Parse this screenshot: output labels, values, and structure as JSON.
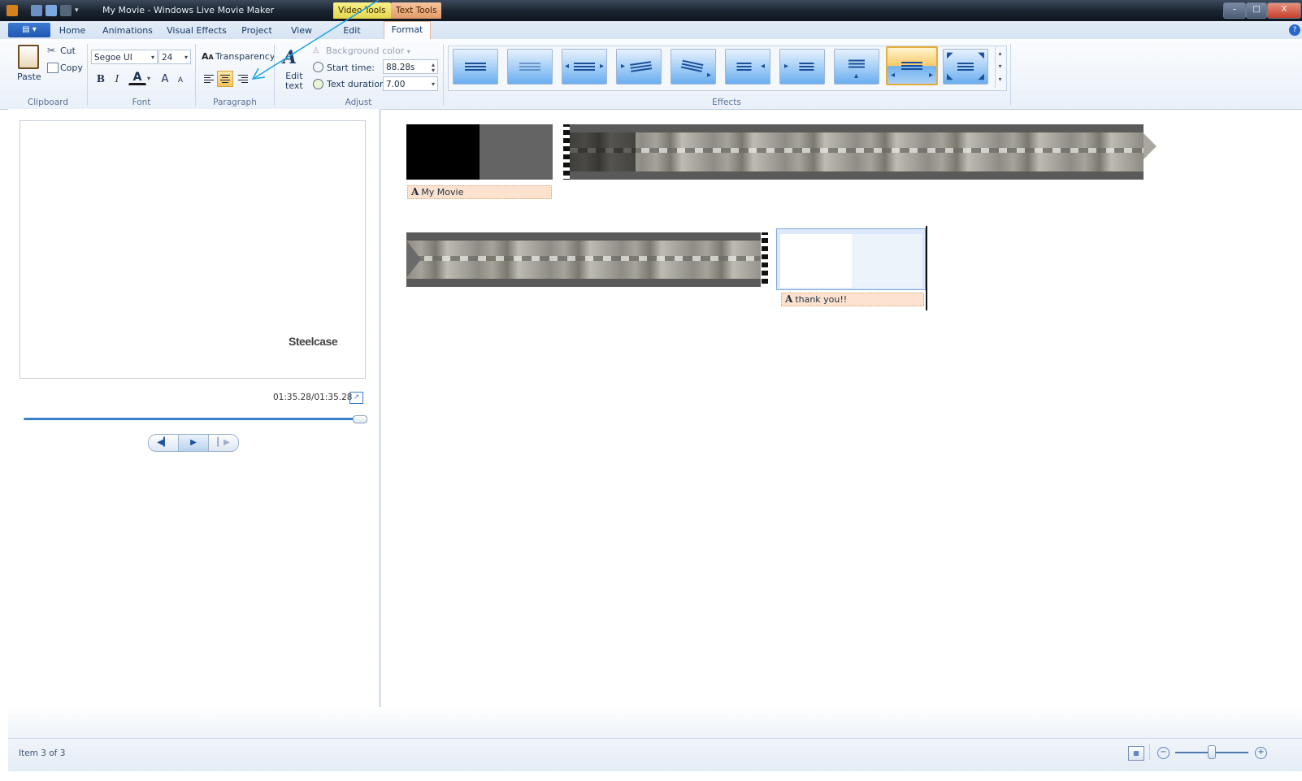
{
  "window": {
    "title": "My Movie - Windows Live Movie Maker",
    "context_tabs": {
      "video_tools": "Video Tools",
      "text_tools": "Text Tools"
    },
    "controls": {
      "minimize": "–",
      "maximize": "□",
      "close": "X"
    }
  },
  "ribbon": {
    "app_menu": "▤ ▾",
    "tabs": [
      "Home",
      "Animations",
      "Visual Effects",
      "Project",
      "View",
      "Edit",
      "Format"
    ],
    "active_tab": "Format",
    "help": "?",
    "clipboard": {
      "paste": "Paste",
      "cut": "Cut",
      "copy": "Copy",
      "group": "Clipboard"
    },
    "font": {
      "family": "Segoe UI",
      "size": "24",
      "bold": "B",
      "italic": "I",
      "color": "A",
      "grow": "A",
      "shrink": "A",
      "group": "Font"
    },
    "paragraph": {
      "transparency": "Transparency",
      "group": "Paragraph",
      "active_align": "center"
    },
    "adjust": {
      "edit_text_1": "Edit",
      "edit_text_2": "text",
      "background_color": "Background color",
      "start_time_label": "Start time:",
      "start_time_value": "88.28s",
      "text_duration_label": "Text duration:",
      "text_duration_value": "7.00",
      "group": "Adjust"
    },
    "effects": {
      "group": "Effects",
      "selected_index": 8,
      "count": 10
    }
  },
  "preview": {
    "overlay_text": "Steelcase",
    "timecode": "01:35.28/01:35.28",
    "seek_progress": 1.0
  },
  "storyboard": {
    "captions": [
      "My Movie",
      "thank you!!"
    ]
  },
  "status": {
    "text": "Item 3 of 3"
  },
  "colors": {
    "accent": "#2b6fd0",
    "annotation_arrow": "#1aa3e0",
    "caption_bg": "#fde3cf"
  }
}
